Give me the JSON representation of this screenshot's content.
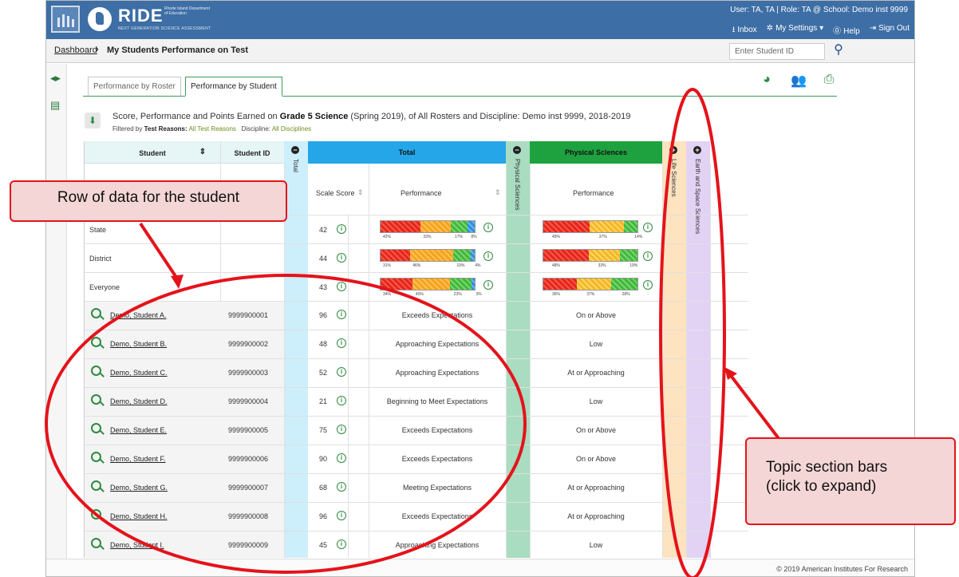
{
  "header": {
    "brand": "RIDE",
    "brand_sub": "Rhode Island Department of Education",
    "brand_tag": "NEXT GENERATION SCIENCE ASSESSMENT",
    "user_line": "User: TA, TA | Role: TA @ School: Demo inst 9999",
    "links": [
      {
        "icon": "inbox-icon",
        "label": "Inbox"
      },
      {
        "icon": "gear-icon",
        "label": "My Settings ▾"
      },
      {
        "icon": "help-icon",
        "label": "Help"
      },
      {
        "icon": "sign-out-icon",
        "label": "Sign Out"
      }
    ]
  },
  "breadcrumb": {
    "link": "Dashboard",
    "title": "My Students Performance on Test",
    "search_placeholder": "Enter Student ID"
  },
  "tabs": [
    "Performance by Roster",
    "Performance by Student"
  ],
  "description": {
    "prefix": "Score, Performance and Points Earned on ",
    "bold": "Grade 5 Science",
    "suffix": " (Spring 2019), of All Rosters and Discipline: Demo inst 9999, 2018-2019",
    "filter_label1": "Filtered by ",
    "filter_key1": "Test Reasons:",
    "filter_val1": "All Test Reasons",
    "filter_key2": "Discipline:",
    "filter_val2": "All Disciplines"
  },
  "columns": {
    "student": "Student",
    "student_id": "Student ID",
    "total_collapsed": "Total",
    "total": "Total",
    "scale_score": "Scale Score",
    "performance": "Performance",
    "physical_collapsed": "Physical Sciences",
    "physical": "Physical Sciences",
    "physical_performance": "Performance",
    "life": "Life Sciences",
    "earth": "Earth and Space Sciences"
  },
  "summary_rows": [
    {
      "label": "State",
      "score": "42",
      "total_pcts": [
        "42%",
        "33%",
        "17%",
        "8%"
      ],
      "phys_pcts": [
        "49%",
        "37%",
        "14%"
      ]
    },
    {
      "label": "District",
      "score": "44",
      "total_pcts": [
        "31%",
        "46%",
        "19%",
        "4%"
      ],
      "phys_pcts": [
        "48%",
        "33%",
        "19%"
      ]
    },
    {
      "label": "Everyone",
      "score": "43",
      "total_pcts": [
        "34%",
        "40%",
        "23%",
        "3%"
      ],
      "phys_pcts": [
        "36%",
        "37%",
        "28%"
      ]
    }
  ],
  "students": [
    {
      "name": "Demo, Student A.",
      "id": "9999900001",
      "score": "96",
      "performance": "Exceeds Expectations",
      "physical": "On or Above"
    },
    {
      "name": "Demo, Student B.",
      "id": "9999900002",
      "score": "48",
      "performance": "Approaching Expectations",
      "physical": "Low"
    },
    {
      "name": "Demo, Student C.",
      "id": "9999900003",
      "score": "52",
      "performance": "Approaching Expectations",
      "physical": "At or Approaching"
    },
    {
      "name": "Demo, Student D.",
      "id": "9999900004",
      "score": "21",
      "performance": "Beginning to Meet Expectations",
      "physical": "Low"
    },
    {
      "name": "Demo, Student E.",
      "id": "9999900005",
      "score": "75",
      "performance": "Exceeds Expectations",
      "physical": "On or Above"
    },
    {
      "name": "Demo, Student F.",
      "id": "9999900006",
      "score": "90",
      "performance": "Exceeds Expectations",
      "physical": "On or Above"
    },
    {
      "name": "Demo, Student G.",
      "id": "9999900007",
      "score": "68",
      "performance": "Meeting Expectations",
      "physical": "At or Approaching"
    },
    {
      "name": "Demo, Student H.",
      "id": "9999900008",
      "score": "96",
      "performance": "Exceeds Expectations",
      "physical": "At or Approaching"
    },
    {
      "name": "Demo, Student I.",
      "id": "9999900009",
      "score": "45",
      "performance": "Approaching Expectations",
      "physical": "Low"
    }
  ],
  "callouts": {
    "row": "Row of data for the student",
    "topic_line1": "Topic section bars",
    "topic_line2": "(click to expand)"
  },
  "footer": "© 2019 American Institutes For Research",
  "colors": {
    "header_blue": "#3d6ea5",
    "total_band": "#cdeefb",
    "total_header": "#25a6e8",
    "physical_band": "#a9dcc0",
    "physical_header": "#1ea23f",
    "life_band": "#fde3bf",
    "earth_band": "#e2d3f5",
    "annotation_red": "#e4131b"
  }
}
